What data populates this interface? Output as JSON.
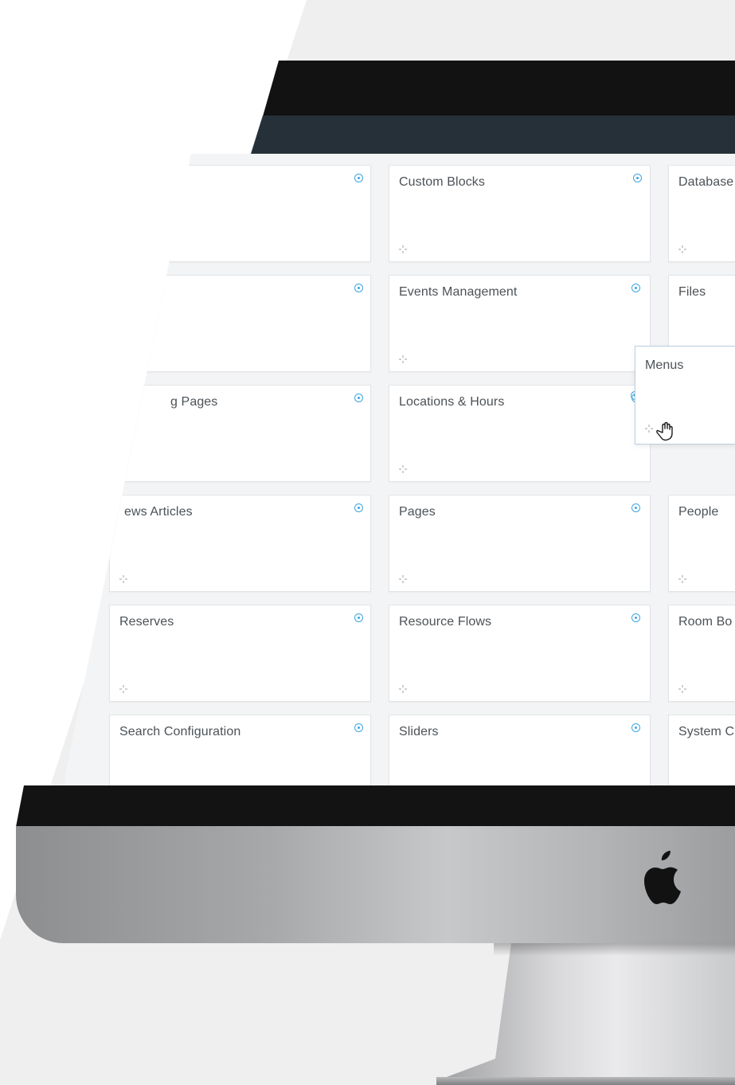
{
  "cards": {
    "row1": {
      "col1": "",
      "col2": "Custom Blocks",
      "col3": "Database"
    },
    "row2": {
      "col1": "",
      "col2": "Events Management",
      "col3": "Files"
    },
    "row3": {
      "col1": "g Pages",
      "col2": "Locations & Hours",
      "col3": ""
    },
    "row4": {
      "col1": "ews Articles",
      "col2": "Pages",
      "col3": "People"
    },
    "row5": {
      "col1": "Reserves",
      "col2": "Resource Flows",
      "col3": "Room Bo"
    },
    "row6": {
      "col1": "Search Configuration",
      "col2": "Sliders",
      "col3": "System C"
    }
  },
  "dragging_card": {
    "title": "Menus"
  },
  "icons": {
    "help": "help-icon",
    "drag": "drag-move-icon",
    "cursor": "hand-grab-cursor-icon",
    "logo": "apple-logo"
  },
  "colors": {
    "header": "#263038",
    "accent": "#3da6de",
    "bezel": "#121212"
  }
}
